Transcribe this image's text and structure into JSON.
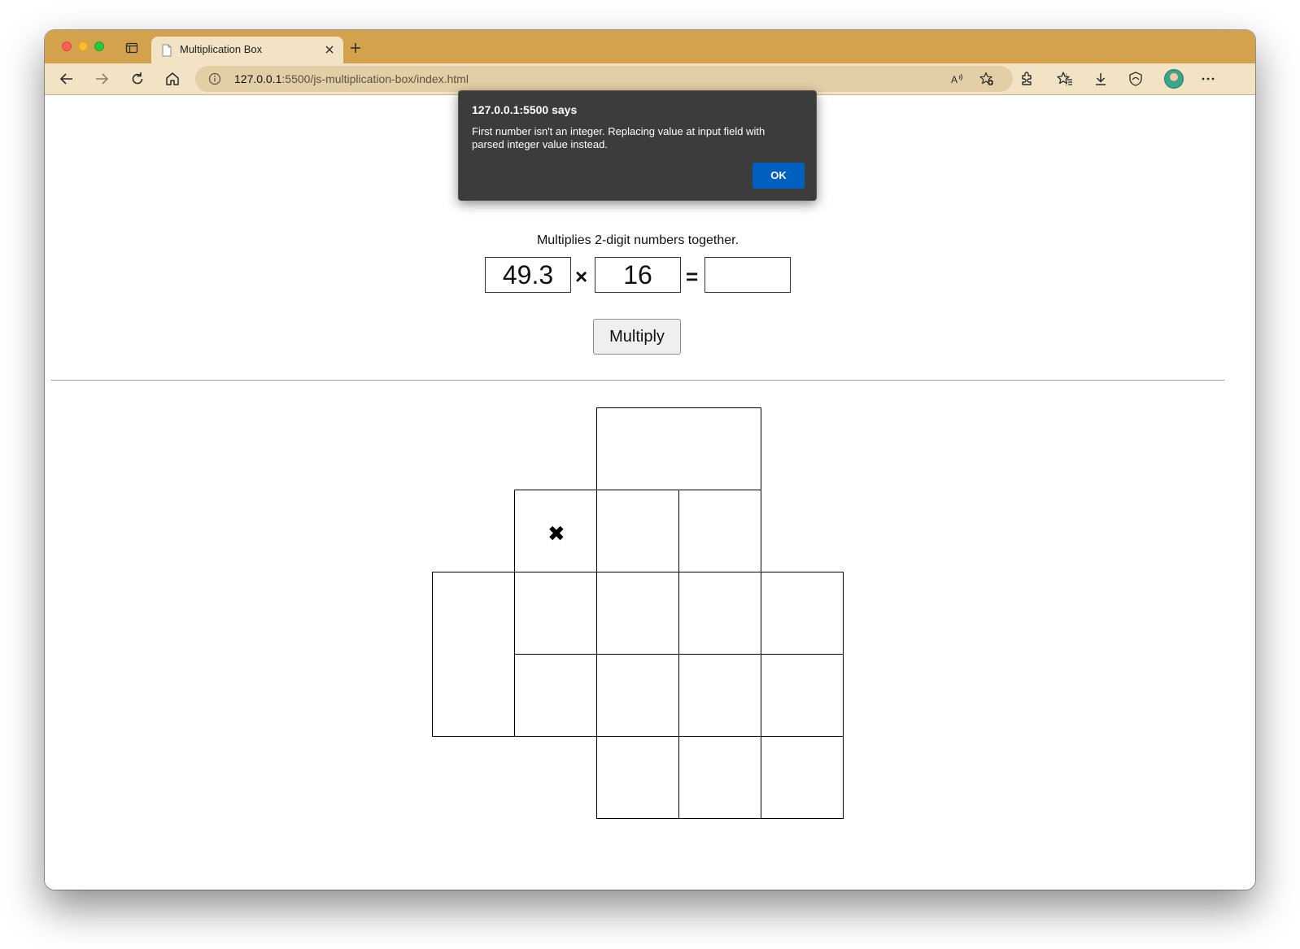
{
  "browser": {
    "tab": {
      "title": "Multiplication Box"
    },
    "address": {
      "host": "127.0.0.1",
      "path": ":5500/js-multiplication-box/index.html"
    },
    "accent_color": "#d4a24c"
  },
  "page": {
    "subtitle": "Multiplies 2-digit numbers together.",
    "first_number": "49.3",
    "times_symbol": "×",
    "second_number": "16",
    "equals_symbol": "=",
    "result": "",
    "multiply_button": "Multiply",
    "box_times_symbol": "✖"
  },
  "dialog": {
    "title": "127.0.0.1:5500 says",
    "message": "First number isn't an integer. Replacing value at input field with parsed integer value instead.",
    "ok_label": "OK",
    "ok_color": "#0060c0"
  }
}
